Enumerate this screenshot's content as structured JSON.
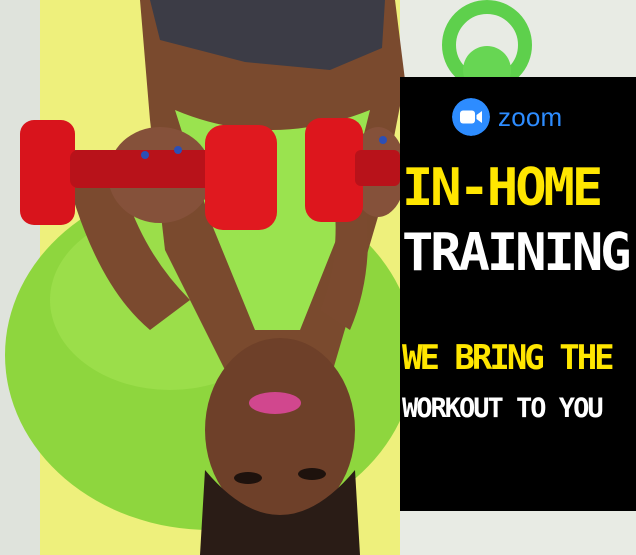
{
  "brand": {
    "name": "zoom",
    "color": "#2d8cff",
    "icon": "video-camera-icon"
  },
  "headline": {
    "line1": "IN-HOME",
    "line2": "TRAINING",
    "line1_color": "#ffe600",
    "line2_color": "#ffffff"
  },
  "tagline": {
    "line1": "WE BRING THE",
    "line2": "WORKOUT TO YOU",
    "line1_color": "#ffe600",
    "line2_color": "#ffffff"
  },
  "photo": {
    "subject": "woman-exercising-with-dumbbells-on-fitness-ball",
    "accent_colors": [
      "#d8141c",
      "#8fd63a",
      "#f0ec6a"
    ]
  }
}
